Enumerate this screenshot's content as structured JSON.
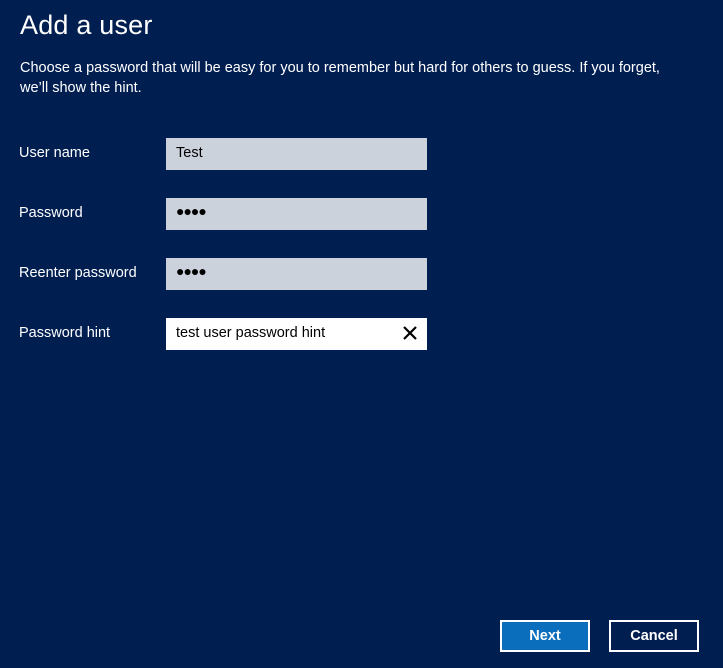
{
  "page": {
    "title": "Add a user",
    "description": "Choose a password that will be easy for you to remember but hard for others to guess. If you forget, we’ll show the hint."
  },
  "form": {
    "username": {
      "label": "User name",
      "value": "Test"
    },
    "password": {
      "label": "Password",
      "value": "●●●●"
    },
    "reenter_password": {
      "label": "Reenter password",
      "value": "●●●●"
    },
    "password_hint": {
      "label": "Password hint",
      "value": "test user password hint",
      "clear_icon": "close-icon"
    }
  },
  "buttons": {
    "next": "Next",
    "cancel": "Cancel"
  },
  "colors": {
    "background": "#001e50",
    "field": "#ccd2dc",
    "accent": "#0a6ebd"
  }
}
